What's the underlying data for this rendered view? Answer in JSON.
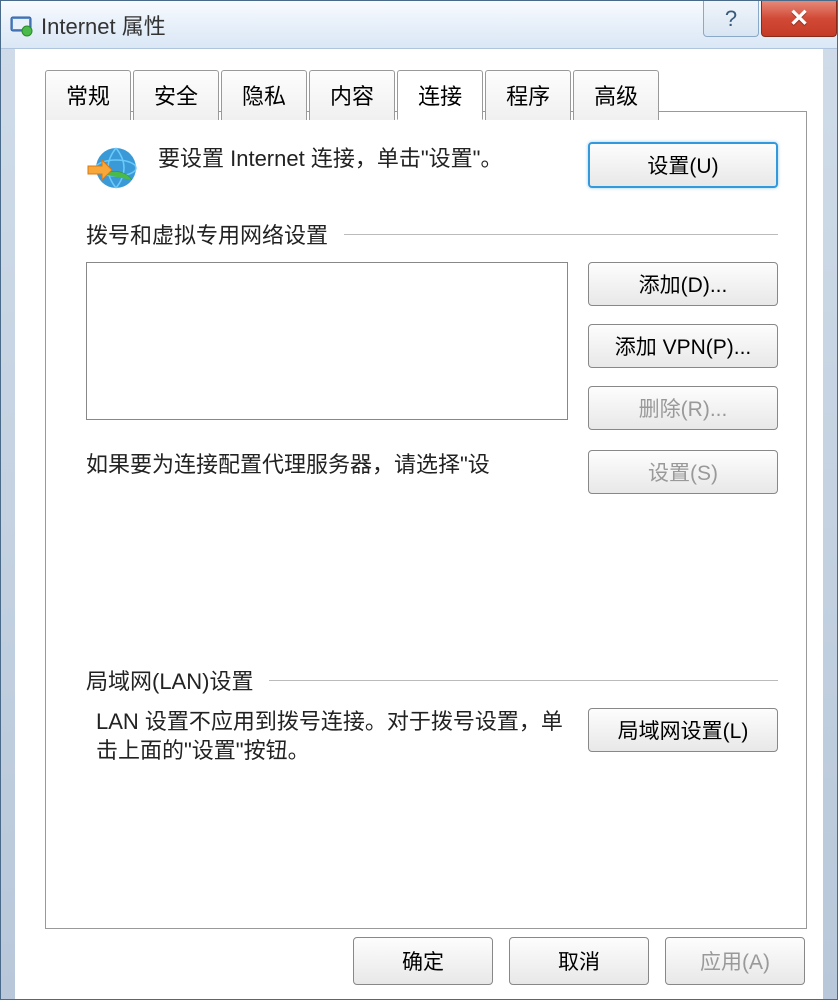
{
  "window": {
    "title": "Internet 属性"
  },
  "titlebar": {
    "help": "?",
    "close": "✕"
  },
  "tabs": [
    {
      "label": "常规"
    },
    {
      "label": "安全"
    },
    {
      "label": "隐私"
    },
    {
      "label": "内容"
    },
    {
      "label": "连接",
      "active": true
    },
    {
      "label": "程序"
    },
    {
      "label": "高级"
    }
  ],
  "setup": {
    "text": "要设置 Internet 连接，单击\"设置\"。",
    "button": "设置(U)"
  },
  "dial": {
    "title": "拨号和虚拟专用网络设置",
    "add": "添加(D)...",
    "addVpn": "添加 VPN(P)...",
    "remove": "删除(R)...",
    "proxyText": "如果要为连接配置代理服务器，请选择\"设",
    "settings": "设置(S)"
  },
  "lan": {
    "title": "局域网(LAN)设置",
    "text": "LAN 设置不应用到拨号连接。对于拨号设置，单击上面的\"设置\"按钮。",
    "button": "局域网设置(L)"
  },
  "buttons": {
    "ok": "确定",
    "cancel": "取消",
    "apply": "应用(A)"
  }
}
